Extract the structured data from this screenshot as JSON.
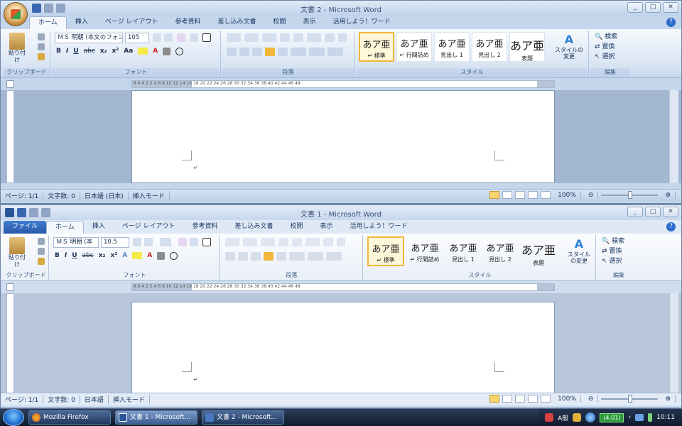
{
  "win1": {
    "title": "文書 2 - Microsoft Word",
    "tabs": [
      "ホーム",
      "挿入",
      "ページ レイアウト",
      "参考資料",
      "差し込み文書",
      "校閲",
      "表示",
      "活用しよう！ワード"
    ],
    "font": {
      "name": "ＭＳ 明朝 (本文のフォン",
      "size": "105"
    },
    "paste_label": "貼り付け",
    "groups": {
      "clipboard": "クリップボード",
      "font": "フォント",
      "paragraph": "段落",
      "styles": "スタイル",
      "edit": "編集"
    },
    "styles": [
      {
        "glyph": "あア亜",
        "name": "↵ 標準"
      },
      {
        "glyph": "あア亜",
        "name": "↵ 行間詰め"
      },
      {
        "glyph": "あア亜",
        "name": "見出し 1"
      },
      {
        "glyph": "あア亜",
        "name": "見出し 2"
      },
      {
        "glyph": "あア亜",
        "name": "表題"
      }
    ],
    "change_style": "スタイルの変更",
    "edit": {
      "find": "検索",
      "replace": "置換",
      "select": "選択"
    },
    "status": {
      "page": "ページ: 1/1",
      "words": "文字数: 0",
      "lang": "日本語 (日本)",
      "mode": "挿入モード",
      "zoom": "100%"
    }
  },
  "win2": {
    "title": "文書 1 - Microsoft Word",
    "file_tab": "ファイル",
    "tabs": [
      "ホーム",
      "挿入",
      "ページ レイアウト",
      "参考資料",
      "差し込み文書",
      "校閲",
      "表示",
      "活用しよう！ワード"
    ],
    "font": {
      "name": "ＭＳ 明朝 (本",
      "size": "10.5"
    },
    "paste_label": "貼り付け",
    "groups": {
      "clipboard": "クリップボード",
      "font": "フォント",
      "paragraph": "段落",
      "styles": "スタイル",
      "edit": "編集"
    },
    "styles": [
      {
        "glyph": "あア亜",
        "name": "↵ 標準"
      },
      {
        "glyph": "あア亜",
        "name": "↵ 行間詰め"
      },
      {
        "glyph": "あア亜",
        "name": "見出し 1"
      },
      {
        "glyph": "あア亜",
        "name": "見出し 2"
      },
      {
        "glyph": "あア亜",
        "name": "表題"
      }
    ],
    "change_style": "スタイルの変更",
    "edit": {
      "find": "検索",
      "replace": "置換",
      "select": "選択"
    },
    "status": {
      "page": "ページ: 1/1",
      "words": "文字数: 0",
      "lang": "日本語",
      "mode": "挿入モード",
      "zoom": "100%"
    }
  },
  "ruler_ticks": "8  6  4  2     2  4  6  8  10  12  14  16  18  20  22  24  26  28  30  32  34  36  38  40  42  44  46  48",
  "taskbar": {
    "items": [
      "Mozilla Firefox",
      "文書 1 - Microsoft...",
      "文書 2 - Microsoft..."
    ],
    "ime": "A般",
    "battery": "(4:01)",
    "clock": "10:11"
  },
  "colors": {
    "accent": "#2b579a",
    "highlight": "#f2b63b"
  }
}
